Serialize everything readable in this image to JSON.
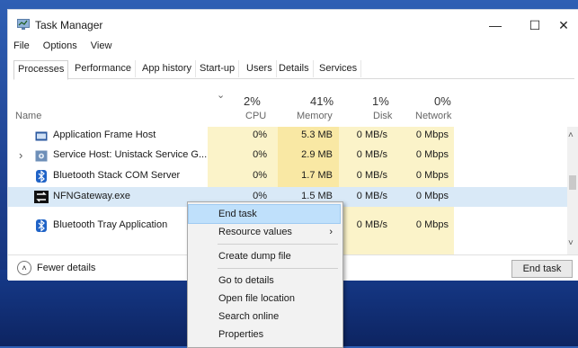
{
  "window": {
    "title": "Task Manager",
    "controls": {
      "minimize": "—",
      "maximize": "☐",
      "close": "✕"
    }
  },
  "menu": [
    "File",
    "Options",
    "View"
  ],
  "tabs": [
    "Processes",
    "Performance",
    "App history",
    "Start-up",
    "Users",
    "Details",
    "Services"
  ],
  "active_tab": "Processes",
  "columns": {
    "name": "Name",
    "sort_indicator": "⌄",
    "cpu": {
      "pct": "2%",
      "label": "CPU"
    },
    "memory": {
      "pct": "41%",
      "label": "Memory"
    },
    "disk": {
      "pct": "1%",
      "label": "Disk"
    },
    "network": {
      "pct": "0%",
      "label": "Network"
    }
  },
  "processes": [
    {
      "name": "Application Frame Host",
      "cpu": "0%",
      "memory": "5.3 MB",
      "disk": "0 MB/s",
      "network": "0 Mbps",
      "expand": "",
      "icon": "app-frame-icon"
    },
    {
      "name": "Service Host: Unistack Service G...",
      "cpu": "0%",
      "memory": "2.9 MB",
      "disk": "0 MB/s",
      "network": "0 Mbps",
      "expand": "›",
      "icon": "gear-icon"
    },
    {
      "name": "Bluetooth Stack COM Server",
      "cpu": "0%",
      "memory": "1.7 MB",
      "disk": "0 MB/s",
      "network": "0 Mbps",
      "expand": "",
      "icon": "bluetooth-icon"
    },
    {
      "name": "NFNGateway.exe",
      "cpu": "0%",
      "memory": "1.5 MB",
      "disk": "0 MB/s",
      "network": "0 Mbps",
      "expand": "",
      "icon": "gateway-icon"
    },
    {
      "name": "Bluetooth Tray Application",
      "cpu": "",
      "memory": "",
      "disk": "0 MB/s",
      "network": "0 Mbps",
      "expand": "",
      "icon": "bluetooth-icon"
    }
  ],
  "footer": {
    "fewer_details": "Fewer details",
    "end_task": "End task"
  },
  "context_menu": {
    "items": [
      "End task",
      "Resource values",
      "Create dump file",
      "Go to details",
      "Open file location",
      "Search online",
      "Properties"
    ],
    "submenu_arrow": "›"
  },
  "scroll": {
    "up": "˄",
    "down": "˅"
  },
  "colors": {
    "cpu_col": "#fbf3c9",
    "mem_col": "#f9e8a4",
    "selected_row": "#d9e9f7",
    "menu_highlight": "#bfe0fb"
  }
}
